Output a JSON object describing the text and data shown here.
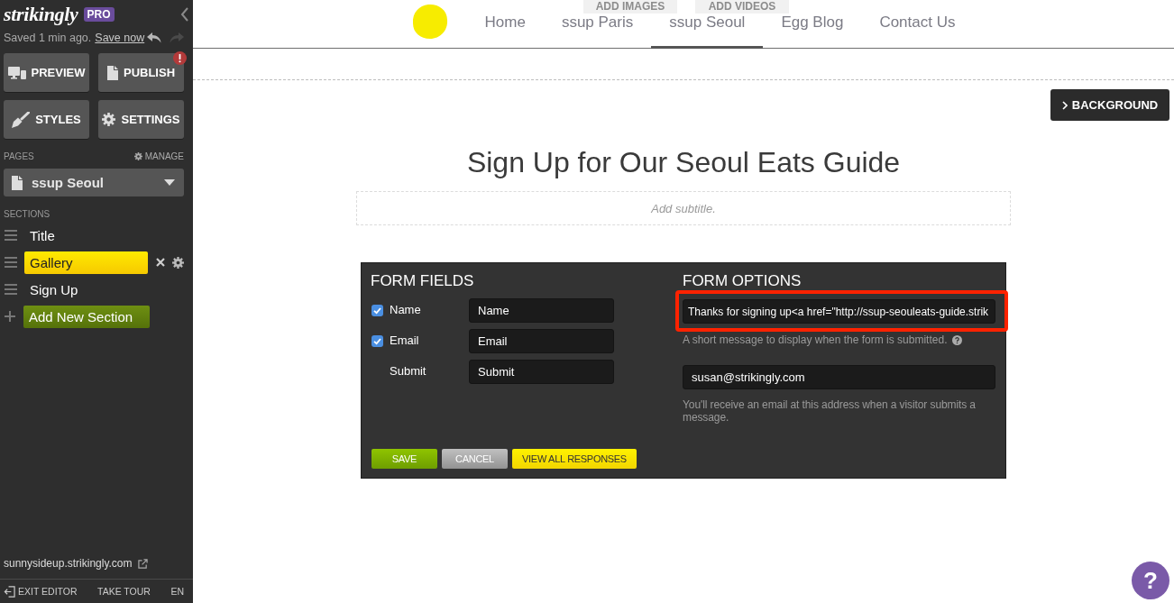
{
  "sidebar": {
    "logo": "strikingly",
    "plan_badge": "PRO",
    "save_status": "Saved 1 min ago.",
    "save_link": "Save now",
    "history": [
      {
        "kind": "undo",
        "disabled": false
      },
      {
        "kind": "redo",
        "disabled": true
      }
    ],
    "actions": [
      {
        "kind": "preview",
        "label": "PREVIEW",
        "alert": false
      },
      {
        "kind": "publish",
        "label": "PUBLISH",
        "alert": true
      },
      {
        "kind": "styles",
        "label": "STYLES",
        "alert": false
      },
      {
        "kind": "settings",
        "label": "SETTINGS",
        "alert": false
      }
    ],
    "pages": {
      "heading": "PAGES",
      "manage": "MANAGE",
      "current": "ssup Seoul"
    },
    "sections": {
      "heading": "SECTIONS",
      "items": [
        {
          "label": "Title",
          "selected": false
        },
        {
          "label": "Gallery",
          "selected": true
        },
        {
          "label": "Sign Up",
          "selected": false
        }
      ],
      "add_button": "Add New Section"
    },
    "site_url": "sunnysideup.strikingly.com",
    "footer": {
      "exit_button": "EXIT EDITOR",
      "tour_button": "TAKE TOUR",
      "language": "EN"
    }
  },
  "site_nav": {
    "overlay_buttons": [
      "ADD IMAGES",
      "ADD VIDEOS"
    ],
    "items": [
      {
        "label": "Home",
        "selected": false
      },
      {
        "label": "ssup Paris",
        "selected": false
      },
      {
        "label": "ssup Seoul",
        "selected": true
      },
      {
        "label": "Egg Blog",
        "selected": false
      },
      {
        "label": "Contact Us",
        "selected": false
      }
    ]
  },
  "background_button": "BACKGROUND",
  "section": {
    "title": "Sign Up for Our Seoul Eats Guide",
    "subtitle": {
      "placeholder": "Add subtitle."
    }
  },
  "form_editor": {
    "fields_heading": "FORM FIELDS",
    "fields": [
      {
        "kind": "checkbox",
        "label": "Name",
        "checked": true,
        "value": "Name"
      },
      {
        "kind": "checkbox",
        "label": "Email",
        "checked": true,
        "value": "Email"
      },
      {
        "kind": "plain",
        "label": "Submit",
        "value": "Submit"
      }
    ],
    "options_heading": "FORM OPTIONS",
    "message": {
      "value": "Thanks for signing up<a href=\"http://ssup-seouleats-guide.strik",
      "highlighted": true,
      "help": "A short message to display when the form is submitted."
    },
    "email": {
      "value": "susan@strikingly.com",
      "help": "You'll receive an email at this address when a visitor submits a message."
    },
    "buttons": [
      {
        "kind": "save",
        "label": "SAVE"
      },
      {
        "kind": "cancel",
        "label": "CANCEL"
      },
      {
        "kind": "responses",
        "label": "VIEW ALL RESPONSES"
      }
    ]
  },
  "help_button": "?"
}
